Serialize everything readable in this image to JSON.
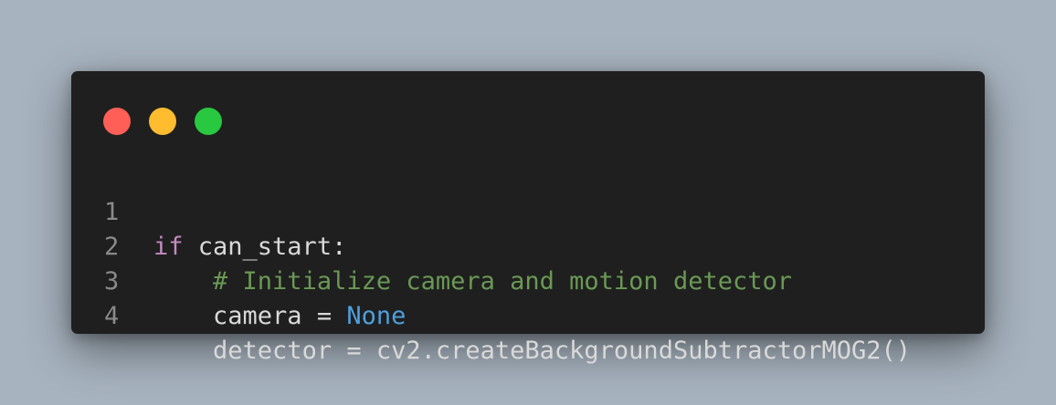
{
  "window": {
    "controls": [
      {
        "name": "close",
        "color": "#ff5f57"
      },
      {
        "name": "minimize",
        "color": "#febc2e"
      },
      {
        "name": "maximize",
        "color": "#28c840"
      }
    ]
  },
  "code": {
    "lines": [
      {
        "number": "1",
        "keyword": "if",
        "text": " can_start:"
      },
      {
        "number": "2",
        "indent": "    ",
        "comment": "# Initialize camera and motion detector"
      },
      {
        "number": "3",
        "indent": "    ",
        "text": "camera = ",
        "constant": "None"
      },
      {
        "number": "4",
        "indent": "    ",
        "text": "detector = cv2.createBackgroundSubtractorMOG2()"
      }
    ]
  }
}
